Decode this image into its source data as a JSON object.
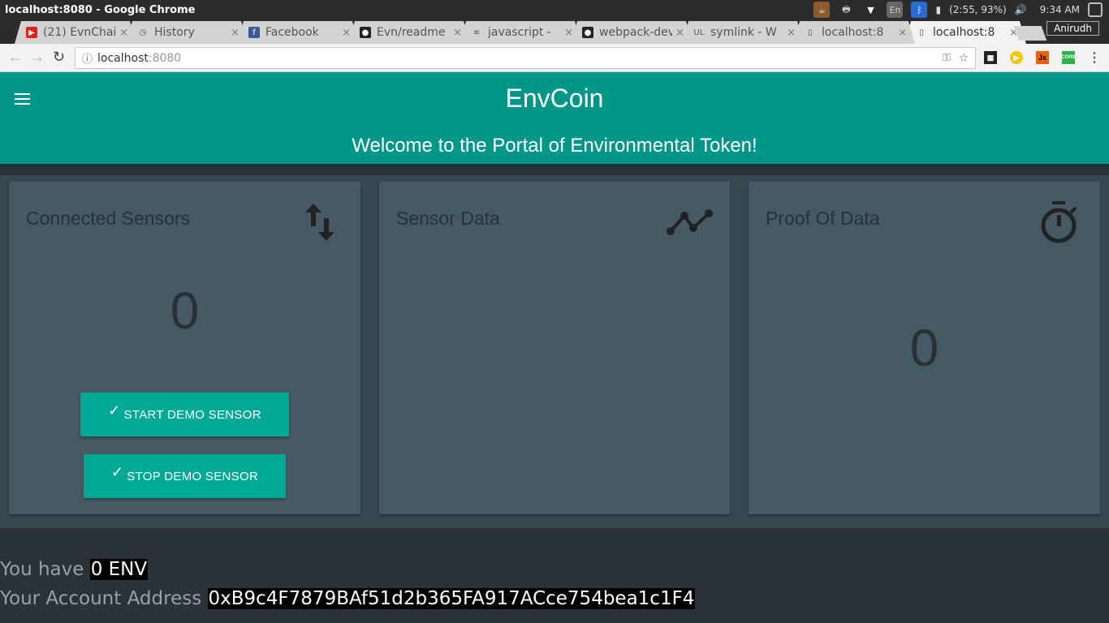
{
  "os": {
    "window_title": "localhost:8080 - Google Chrome",
    "battery": "(2:55, 93%)",
    "clock": "9:34 AM",
    "keyboard": "En"
  },
  "browser": {
    "tabs": [
      {
        "label": "(21) EvnChain",
        "icon": "youtube-icon"
      },
      {
        "label": "History",
        "icon": "history-icon"
      },
      {
        "label": "Facebook",
        "icon": "facebook-icon"
      },
      {
        "label": "Evn/readme",
        "icon": "github-icon"
      },
      {
        "label": "javascript -",
        "icon": "stackoverflow-icon"
      },
      {
        "label": "webpack-dev",
        "icon": "github-icon"
      },
      {
        "label": "symlink - W",
        "icon": "ul-icon"
      },
      {
        "label": "localhost:8",
        "icon": "page-icon"
      },
      {
        "label": "localhost:8",
        "icon": "page-icon",
        "active": true
      }
    ],
    "user": "Anirudh",
    "url_host": "localhost",
    "url_port": ":8080",
    "close_glyph": "×"
  },
  "app": {
    "title": "EnvCoin",
    "welcome": "Welcome to the Portal of Environmental Token!",
    "colors": {
      "header": "#009688",
      "card": "#455a64",
      "button": "#00a896"
    },
    "cards": [
      {
        "title": "Connected Sensors",
        "icon": "swap-vert-icon",
        "value": "0",
        "buttons": [
          {
            "label": "START DEMO SENSOR",
            "icon": "check-icon"
          },
          {
            "label": "STOP DEMO SENSOR",
            "icon": "check-icon"
          }
        ]
      },
      {
        "title": "Sensor Data",
        "icon": "timeline-icon"
      },
      {
        "title": "Proof Of Data",
        "icon": "timer-icon",
        "value": "0"
      }
    ],
    "balance_label": "You have",
    "balance_value": "0 ENV",
    "address_label": "Your Account Address",
    "address_value": "0xB9c4F7879BAf51d2b365FA917ACce754bea1c1F4"
  }
}
